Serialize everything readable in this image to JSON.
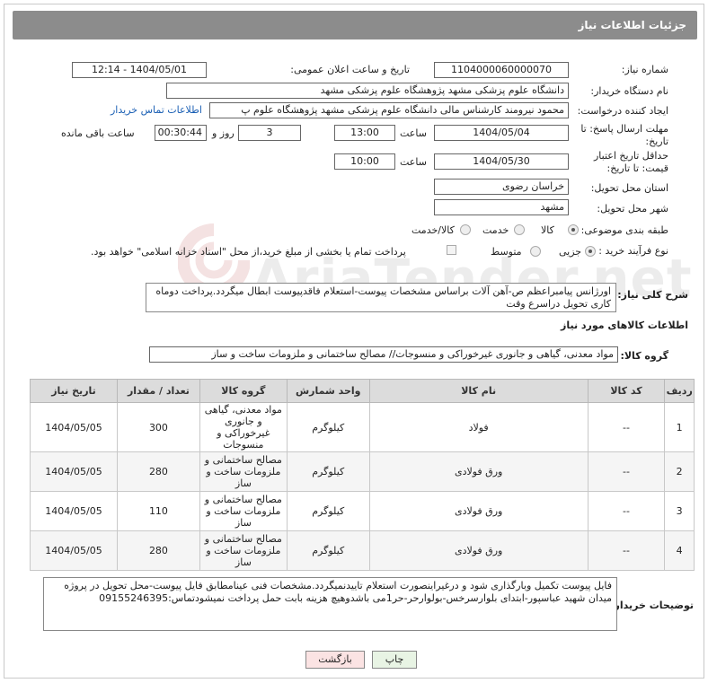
{
  "page_title": "جزئیات اطلاعات نیاز",
  "fields": {
    "need_number": {
      "label": "شماره نیاز:",
      "value": "1104000060000070"
    },
    "announce_date": {
      "label": "تاریخ و ساعت اعلان عمومی:",
      "value": "1404/05/01 - 12:14"
    },
    "buyer_org": {
      "label": "نام دستگاه خریدار:",
      "value": "دانشگاه علوم پزشکی مشهد   پژوهشگاه علوم پزشکی مشهد"
    },
    "requester": {
      "label": "ایجاد کننده درخواست:",
      "value": "محمود نیرومند کارشناس مالی دانشگاه علوم پزشکی مشهد   پژوهشگاه علوم پ",
      "contact_link": "اطلاعات تماس خریدار"
    },
    "reply_deadline": {
      "label": "مهلت ارسال پاسخ: تا تاریخ:",
      "date": "1404/05/04",
      "time_label": "ساعت",
      "time": "13:00",
      "days": "3",
      "days_label": "روز و",
      "remaining": "00:30:44",
      "remaining_label": "ساعت باقی مانده"
    },
    "price_validity": {
      "label": "حداقل تاریخ اعتبار قیمت: تا تاریخ:",
      "date": "1404/05/30",
      "time_label": "ساعت",
      "time": "10:00"
    },
    "delivery_province": {
      "label": "استان محل تحویل:",
      "value": "خراسان رضوی"
    },
    "delivery_city": {
      "label": "شهر محل تحویل:",
      "value": "مشهد"
    },
    "category": {
      "label": "طبقه بندی موضوعی:",
      "options": [
        "کالا",
        "خدمت",
        "کالا/خدمت"
      ],
      "selected": "کالا"
    },
    "process_type": {
      "label": "نوع فرآیند خرید :",
      "options": [
        "جزیی",
        "متوسط"
      ],
      "selected": "جزیی",
      "payment_note": "پرداخت تمام یا بخشی از مبلغ خرید،از محل \"اسناد خزانه اسلامی\" خواهد بود."
    },
    "summary": {
      "label": "شرح کلی نیاز:",
      "value": "اورژانس پیامبراعظم ص-آهن آلات براساس مشخصات پیوست-استعلام فاقدپیوست ابطال میگردد.پرداخت دوماه کاری تحویل دراسرع وقت"
    }
  },
  "goods_section_title": "اطلاعات کالاهای مورد نیاز",
  "goods_group": {
    "label": "گروه کالا:",
    "value": "مواد معدنی، گیاهی و جانوری غیرخوراکی و منسوجات// مصالح ساختمانی و ملزومات ساخت و ساز"
  },
  "table": {
    "headers": [
      "ردیف",
      "کد کالا",
      "نام کالا",
      "واحد شمارش",
      "گروه کالا",
      "تعداد / مقدار",
      "تاریخ نیاز"
    ],
    "rows": [
      {
        "row": "1",
        "code": "--",
        "name": "فولاد",
        "unit": "کیلوگرم",
        "group": "مواد معدنی، گیاهی و جانوری غیرخوراکی و منسوجات",
        "qty": "300",
        "date": "1404/05/05"
      },
      {
        "row": "2",
        "code": "--",
        "name": "ورق فولادی",
        "unit": "کیلوگرم",
        "group": "مصالح ساختمانی و ملزومات ساخت و ساز",
        "qty": "280",
        "date": "1404/05/05"
      },
      {
        "row": "3",
        "code": "--",
        "name": "ورق فولادی",
        "unit": "کیلوگرم",
        "group": "مصالح ساختمانی و ملزومات ساخت و ساز",
        "qty": "110",
        "date": "1404/05/05"
      },
      {
        "row": "4",
        "code": "--",
        "name": "ورق فولادی",
        "unit": "کیلوگرم",
        "group": "مصالح ساختمانی و ملزومات ساخت و ساز",
        "qty": "280",
        "date": "1404/05/05"
      }
    ]
  },
  "buyer_notes": {
    "label": "توضیحات خریدار:",
    "value": "فایل پیوست تکمیل وبارگذاری شود و درغیراینصورت استعلام تاییدنمیگردد.مشخصات فنی عینامطابق فایل پیوست-محل تحویل در پروژه میدان شهید عباسپور-ابتدای بلوارسرخس-بولوارحر-حر1می باشدوهیچ هزینه بابت حمل  پرداخت نمیشودتماس:09155246395"
  },
  "buttons": {
    "print": "چاپ",
    "back": "بازگشت"
  },
  "watermark": "AriaTender.net"
}
